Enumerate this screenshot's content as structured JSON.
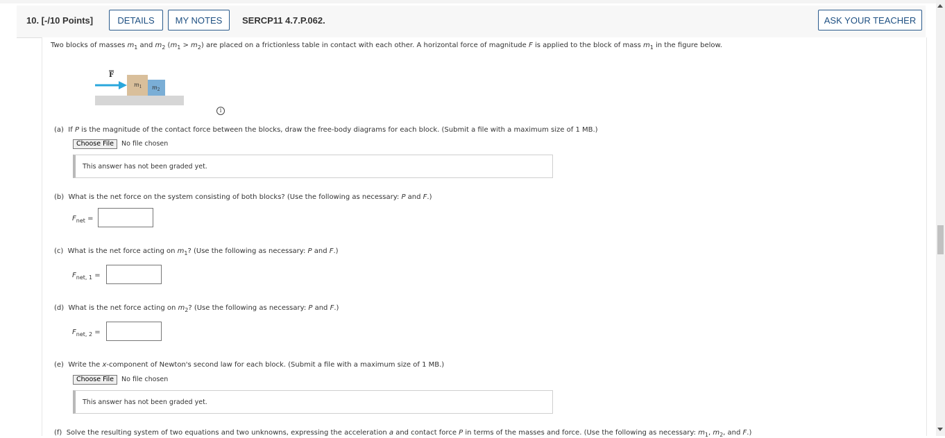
{
  "header": {
    "question_number": "10. [-/10 Points]",
    "details_label": "DETAILS",
    "my_notes_label": "MY NOTES",
    "problem_code": "SERCP11 4.7.P.062.",
    "ask_teacher_label": "ASK YOUR TEACHER"
  },
  "problem": {
    "intro_1": "Two blocks of masses ",
    "m1_base": "m",
    "m1_sub": "1",
    "and": " and ",
    "m2_base": "m",
    "m2_sub": "2",
    "paren_open": " (",
    "gt": " > ",
    "paren_close": ")",
    "intro_2": " are placed on a frictionless table in contact with each other. A horizontal force of magnitude ",
    "F": "F",
    "intro_3": " is applied to the block of mass ",
    "intro_4": " in the figure below."
  },
  "figure": {
    "force_label": "F",
    "block1_label": "m",
    "block1_sub": "1",
    "block2_label": "m",
    "block2_sub": "2",
    "colors": {
      "arrow": "#2aa7dc",
      "block1": "#d9bf9b",
      "block2": "#7aaed6",
      "table": "#d6d6d6"
    }
  },
  "info_icon": "i",
  "parts": {
    "a": {
      "label": "(a)",
      "q1": "If ",
      "P": "P",
      "q2": " is the magnitude of the contact force between the blocks, draw the free-body diagrams for each block. (Submit a file with a maximum size of 1 MB.)",
      "choose_file": "Choose File",
      "no_file": "No file chosen",
      "grade_text": "This answer has not been graded yet."
    },
    "b": {
      "label": "(b)",
      "q": "What is the net force on the system consisting of both blocks? (Use the following as necessary: ",
      "P": "P",
      "and": " and ",
      "F": "F",
      "end": ".)",
      "var_base": "F",
      "var_sub": "net",
      "eq": " ="
    },
    "c": {
      "label": "(c)",
      "q1": "What is the net force acting on ",
      "m": "m",
      "m_sub": "1",
      "q2": "? (Use the following as necessary: ",
      "P": "P",
      "and": " and ",
      "F": "F",
      "end": ".)",
      "var_base": "F",
      "var_sub": "net, 1",
      "eq": " ="
    },
    "d": {
      "label": "(d)",
      "q1": "What is the net force acting on ",
      "m": "m",
      "m_sub": "2",
      "q2": "? (Use the following as necessary: ",
      "P": "P",
      "and": " and ",
      "F": "F",
      "end": ".)",
      "var_base": "F",
      "var_sub": "net, 2",
      "eq": " ="
    },
    "e": {
      "label": "(e)",
      "q1": "Write the ",
      "x": "x",
      "q2": "-component of Newton's second law for each block. (Submit a file with a maximum size of 1 MB.)",
      "choose_file": "Choose File",
      "no_file": "No file chosen",
      "grade_text": "This answer has not been graded yet."
    },
    "f": {
      "label": "(f)",
      "q1": "Solve the resulting system of two equations and two unknowns, expressing the acceleration ",
      "a": "a",
      "q2": " and contact force ",
      "P": "P",
      "q3": " in terms of the masses and force. (Use the following as necessary: ",
      "m1": "m",
      "m1_sub": "1",
      "comma": ", ",
      "m2": "m",
      "m2_sub": "2",
      "and": ", and ",
      "F": "F",
      "end": ".)"
    }
  }
}
